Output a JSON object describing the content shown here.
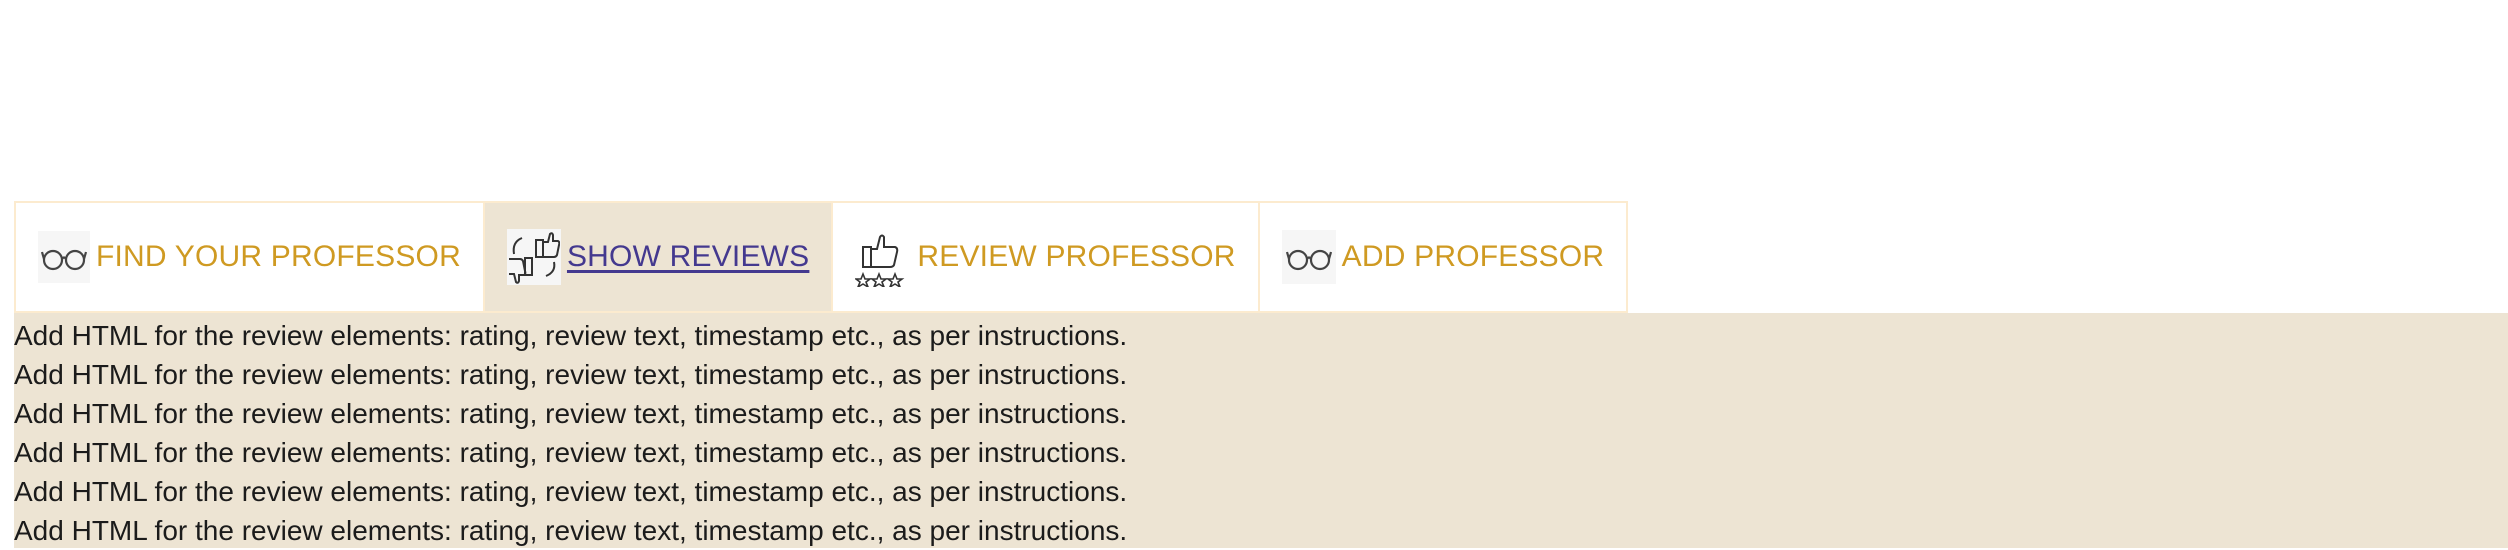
{
  "nav": {
    "tabs": [
      {
        "label": "FIND YOUR PROFESSOR",
        "icon": "glasses-icon",
        "active": false
      },
      {
        "label": "SHOW REVIEWS",
        "icon": "thumbs-up-down-icon",
        "active": true
      },
      {
        "label": "REVIEW PROFESSOR",
        "icon": "thumbs-up-stars-icon",
        "active": false
      },
      {
        "label": "ADD PROFESSOR",
        "icon": "glasses-icon",
        "active": false
      }
    ]
  },
  "reviews": {
    "lines": [
      "Add HTML for the review elements: rating, review text, timestamp etc., as per instructions.",
      "Add HTML for the review elements: rating, review text, timestamp etc., as per instructions.",
      "Add HTML for the review elements: rating, review text, timestamp etc., as per instructions.",
      "Add HTML for the review elements: rating, review text, timestamp etc., as per instructions.",
      "Add HTML for the review elements: rating, review text, timestamp etc., as per instructions.",
      "Add HTML for the review elements: rating, review text, timestamp etc., as per instructions."
    ]
  },
  "colors": {
    "tab_text": "#cf9a22",
    "active_tab_text": "#44398f",
    "active_bg": "#ede4d3",
    "tab_border": "#fcebcf"
  }
}
